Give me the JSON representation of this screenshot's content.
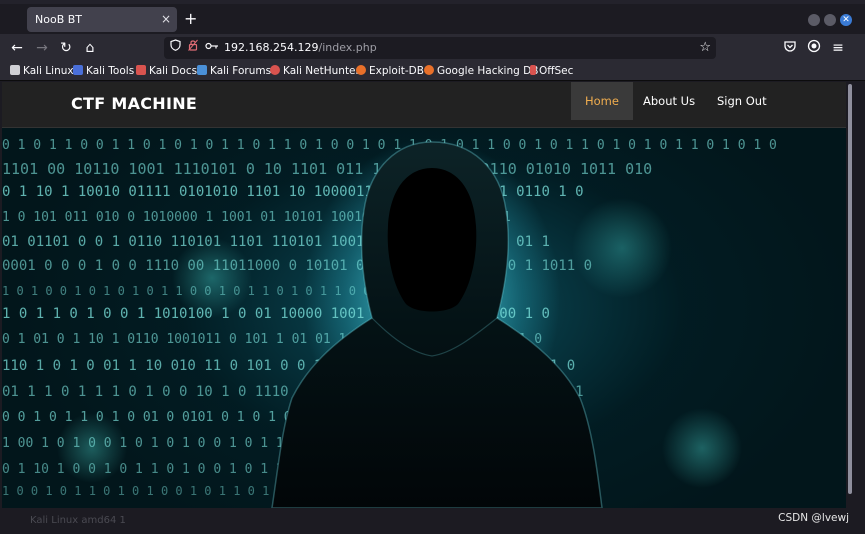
{
  "browser": {
    "tab_title": "NooB BT",
    "tab_close": "×",
    "new_tab": "+",
    "url_host": "192.168.254.129",
    "url_path": "/index.php",
    "nav": {
      "back": "←",
      "forward": "→",
      "reload": "↻",
      "home": "⌂"
    },
    "bookmarks": [
      {
        "label": "Kali Linux",
        "icon": "kali-icon",
        "color": "#cfcfd4"
      },
      {
        "label": "Kali Tools",
        "icon": "kali-tools-icon",
        "color": "#d9534f"
      },
      {
        "label": "Kali Docs",
        "icon": "kali-docs-icon",
        "color": "#d9534f"
      },
      {
        "label": "Kali Forums",
        "icon": "kali-forums-icon",
        "color": "#4a90d9"
      },
      {
        "label": "Kali NetHunter",
        "icon": "nethunter-icon",
        "color": "#d9534f"
      },
      {
        "label": "Exploit-DB",
        "icon": "exploit-db-icon",
        "color": "#e8702a"
      },
      {
        "label": "Google Hacking DB",
        "icon": "ghdb-icon",
        "color": "#e8702a"
      },
      {
        "label": "OffSec",
        "icon": "offsec-icon",
        "color": "#d9534f"
      }
    ]
  },
  "site": {
    "brand": "CTF MACHINE",
    "menu": [
      {
        "label": "Home",
        "active": true
      },
      {
        "label": "About Us",
        "active": false
      },
      {
        "label": "Sign Out",
        "active": false
      }
    ],
    "accent_color": "#f0ad4e"
  },
  "status": {
    "left_text": "Kali Linux amd64 1",
    "watermark": "CSDN @lvewj"
  }
}
